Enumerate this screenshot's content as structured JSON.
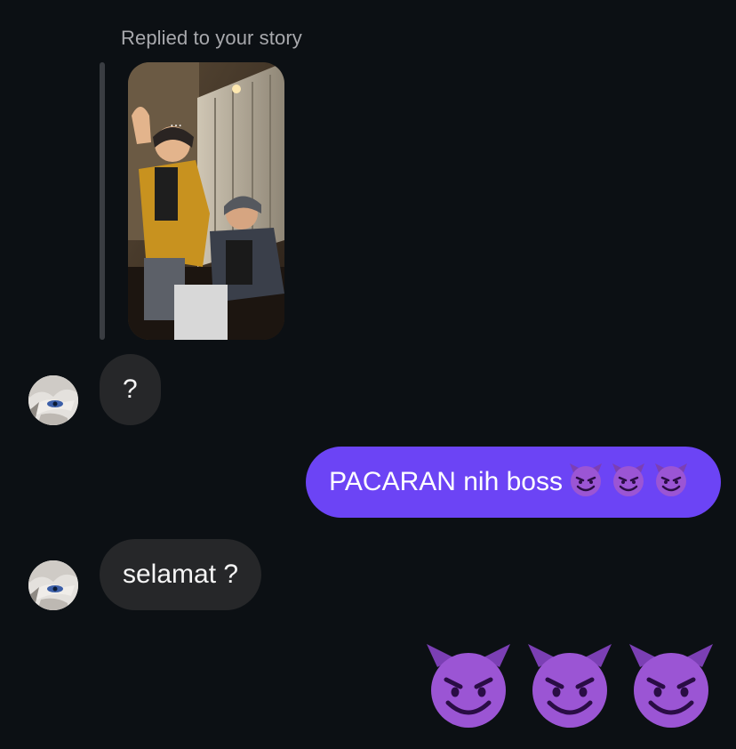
{
  "story_reply": {
    "label": "Replied to your story",
    "thumbnail_icon": "story-photo"
  },
  "messages": [
    {
      "direction": "incoming",
      "text": "?",
      "avatar_icon": "anime-avatar"
    },
    {
      "direction": "outgoing",
      "text": "PACARAN nih boss",
      "emoji": [
        "😈",
        "😈",
        "😈"
      ]
    },
    {
      "direction": "incoming",
      "text": "selamat ?",
      "avatar_icon": "anime-avatar"
    },
    {
      "direction": "outgoing",
      "big_emoji": [
        "😈",
        "😈",
        "😈"
      ]
    }
  ],
  "colors": {
    "background": "#0c1014",
    "incoming_bubble": "#262729",
    "outgoing_bubble": "#6c44f5",
    "secondary_text": "#a8a9ad"
  }
}
